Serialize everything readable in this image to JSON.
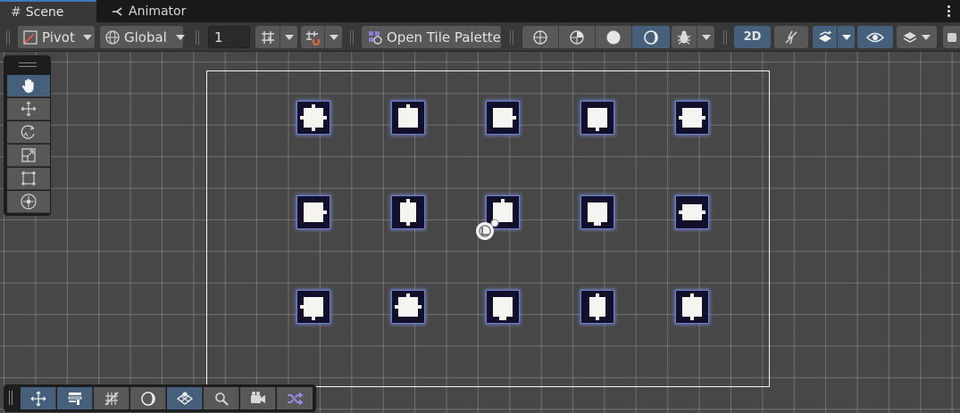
{
  "tabs": {
    "scene": {
      "label": "Scene",
      "icon": "hash-grid-icon"
    },
    "animator": {
      "label": "Animator",
      "icon": "animator-graph-icon"
    },
    "menu_icon": "vertical-ellipsis-icon"
  },
  "toolbar": {
    "pivot_label": "Pivot",
    "global_label": "Global",
    "grid_size_value": "1",
    "open_tile_palette_label": "Open Tile Palette",
    "mode_2d_label": "2D",
    "accent_color": "#46607c"
  },
  "tools": [
    "hand-icon",
    "move-icon",
    "rotate-icon",
    "scale-icon",
    "rect-icon",
    "transform-icon"
  ],
  "active_tool": "hand-icon",
  "bottom_tools": [
    "move-icon",
    "properties-icon",
    "grid-toggle-icon",
    "shading-icon",
    "tilemap-focus-icon",
    "search-icon",
    "camera-icon",
    "shuffle-icon"
  ],
  "scene": {
    "background_color": "#474747",
    "tile_color": "#120f2a",
    "tile_outline_color": "#6c7fd0",
    "tiles": [
      [
        "tile-4way-icon",
        "tile-down-icon",
        "tile-right-icon",
        "tile-down-icon",
        "tile-left-right-icon"
      ],
      [
        "tile-right-icon",
        "tile-up-down-icon",
        "tile-up-icon",
        "tile-down-icon",
        "tile-left-right-icon"
      ],
      [
        "tile-left-right-icon",
        "tile-4way-icon",
        "tile-up-down-icon",
        "tile-up-down-icon",
        "tile-up-down-icon"
      ]
    ]
  }
}
